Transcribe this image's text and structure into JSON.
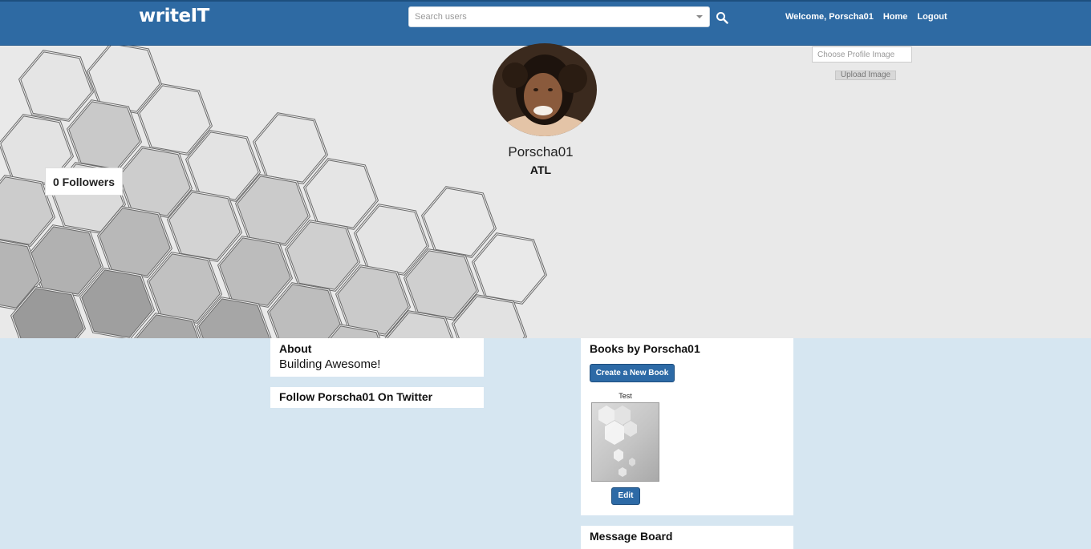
{
  "navbar": {
    "logo": "writeIT",
    "search_placeholder": "Search users",
    "welcome": "Welcome, Porscha01",
    "home": "Home",
    "logout": "Logout"
  },
  "profile": {
    "username": "Porscha01",
    "location": "ATL",
    "followers": "0 Followers",
    "choose_image": "Choose Profile Image",
    "upload_image": "Upload Image"
  },
  "about": {
    "title": "About",
    "text": "Building Awesome!"
  },
  "twitter": {
    "title": "Follow Porscha01 On Twitter"
  },
  "books": {
    "title": "Books by Porscha01",
    "create_label": "Create a New Book",
    "items": [
      {
        "title": "Test",
        "edit_label": "Edit"
      }
    ]
  },
  "message_board": {
    "title": "Message Board"
  },
  "colors": {
    "navbar": "#2e6aa3",
    "page_background": "#d6e6f1",
    "banner_background": "#e9e9e9",
    "button": "#2d6aa6"
  }
}
